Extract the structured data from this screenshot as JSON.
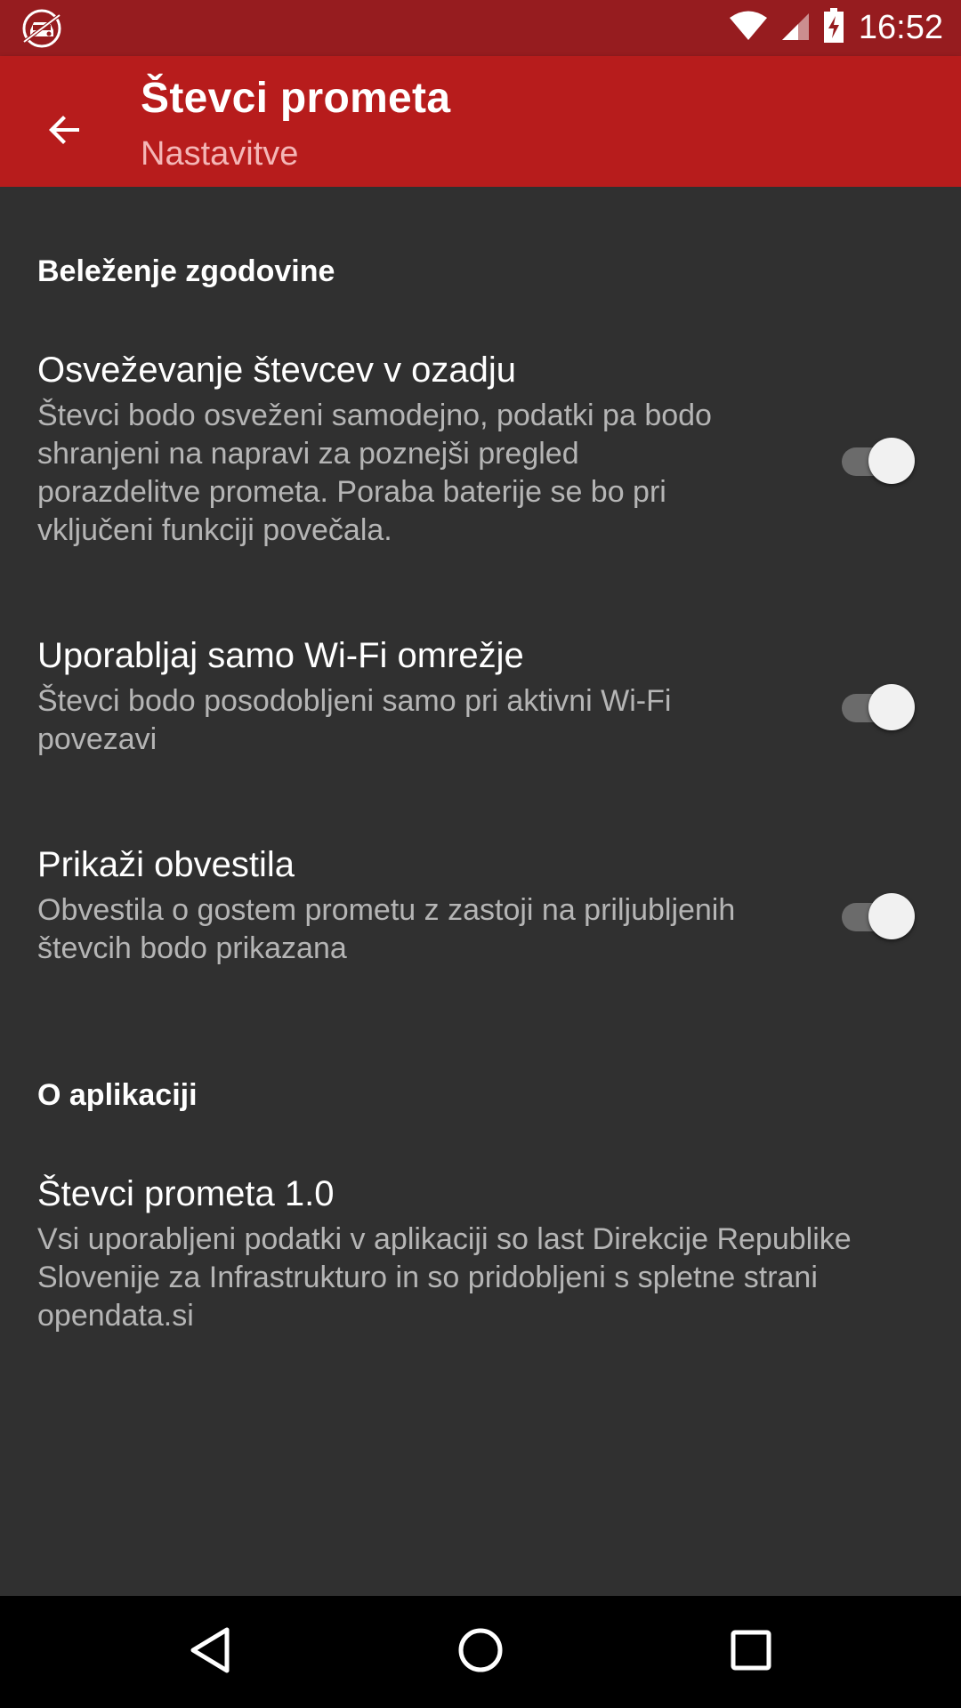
{
  "status_bar": {
    "time": "16:52",
    "icons": [
      "app-notification-icon",
      "wifi-icon",
      "cell-signal-icon",
      "battery-charging-icon"
    ]
  },
  "toolbar": {
    "title": "Števci prometa",
    "subtitle": "Nastavitve",
    "back_icon": "arrow-back-icon"
  },
  "sections": {
    "history": {
      "header": "Beleženje zgodovine",
      "prefs": [
        {
          "title": "Osveževanje števcev v ozadju",
          "summary": "Števci bodo osveženi samodejno, podatki pa bodo shranjeni na napravi za poznejši pregled porazdelitve prometa. Poraba baterije se bo pri vključeni funkciji povečala.",
          "enabled": true
        },
        {
          "title": "Uporabljaj samo Wi-Fi omrežje",
          "summary": "Števci bodo posodobljeni samo pri aktivni Wi-Fi povezavi",
          "enabled": true
        },
        {
          "title": "Prikaži obvestila",
          "summary": "Obvestila o gostem prometu z zastoji na priljubljenih števcih bodo prikazana",
          "enabled": true
        }
      ]
    },
    "about": {
      "header": "O aplikaciji",
      "item": {
        "title": "Števci prometa 1.0",
        "summary": "Vsi uporabljeni podatki v aplikaciji so last Direkcije Republike Slovenije za Infrastrukturo in so pridobljeni s spletne strani opendata.si"
      }
    }
  },
  "nav_bar": {
    "buttons": [
      "back-triangle-icon",
      "home-circle-icon",
      "recents-square-icon"
    ]
  },
  "colors": {
    "status_bar": "#961c1f",
    "toolbar": "#b71c1c",
    "background": "#303030",
    "subtitle": "#f4b6b6",
    "summary_text": "#b5b5b5"
  }
}
